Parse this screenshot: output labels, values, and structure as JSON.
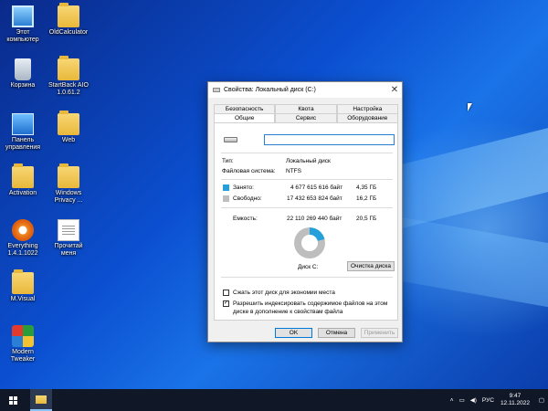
{
  "desktop": {
    "icons": [
      {
        "label": "Этот компьютер",
        "icon": "computer-icon"
      },
      {
        "label": "OldCalculator",
        "icon": "folder-icon"
      },
      {
        "label": "Корзина",
        "icon": "recycle-bin-icon"
      },
      {
        "label": "StartBack AIO 1.0.61.2",
        "icon": "folder-icon"
      },
      {
        "label": "Панель управления",
        "icon": "control-panel-icon"
      },
      {
        "label": "Web",
        "icon": "folder-icon"
      },
      {
        "label": "Activation",
        "icon": "folder-icon"
      },
      {
        "label": "Windows Privacy ...",
        "icon": "folder-icon"
      },
      {
        "label": "Everything 1.4.1.1022",
        "icon": "everything-icon"
      },
      {
        "label": "Прочитай меня",
        "icon": "document-icon"
      },
      {
        "label": "M.Visual",
        "icon": "folder-icon"
      },
      {
        "label": "Modern Tweaker",
        "icon": "tweaker-icon"
      }
    ]
  },
  "dialog": {
    "title": "Свойства: Локальный диск (C:)",
    "close_glyph": "✕",
    "tabs_row1": [
      "Безопасность",
      "Квота",
      "Настройка"
    ],
    "tabs_row2": [
      "Общие",
      "Сервис",
      "Оборудование"
    ],
    "active_tab": "Общие",
    "drive_name_value": "",
    "type_label": "Тип:",
    "type_value": "Локальный диск",
    "fs_label": "Файловая система:",
    "fs_value": "NTFS",
    "used_label": "Занято:",
    "used_bytes": "4 677 615 616 байт",
    "used_size": "4,35 ГБ",
    "free_label": "Свободно:",
    "free_bytes": "17 432 653 824 байт",
    "free_size": "16,2 ГБ",
    "capacity_label": "Емкость:",
    "capacity_bytes": "22 110 269 440 байт",
    "capacity_size": "20,5 ГБ",
    "disk_label": "Диск C:",
    "cleanup_button": "Очистка диска",
    "compress_label": "Сжать этот диск для экономии места",
    "compress_checked": false,
    "index_label_line1": "Разрешить индексировать содержимое файлов на этом",
    "index_label_line2": "диске в дополнение к свойствам файла",
    "index_checked": true,
    "check_glyph": "✓",
    "ok_button": "OK",
    "cancel_button": "Отмена",
    "apply_button": "Применить",
    "used_color": "#26a0da",
    "free_color": "#bebebe",
    "used_fraction": 0.2116
  },
  "taskbar": {
    "lang": "РУС",
    "time": "9:47",
    "date": "12.11.2022",
    "tray_icons": [
      "chevron-up-icon",
      "network-icon",
      "volume-icon"
    ]
  }
}
